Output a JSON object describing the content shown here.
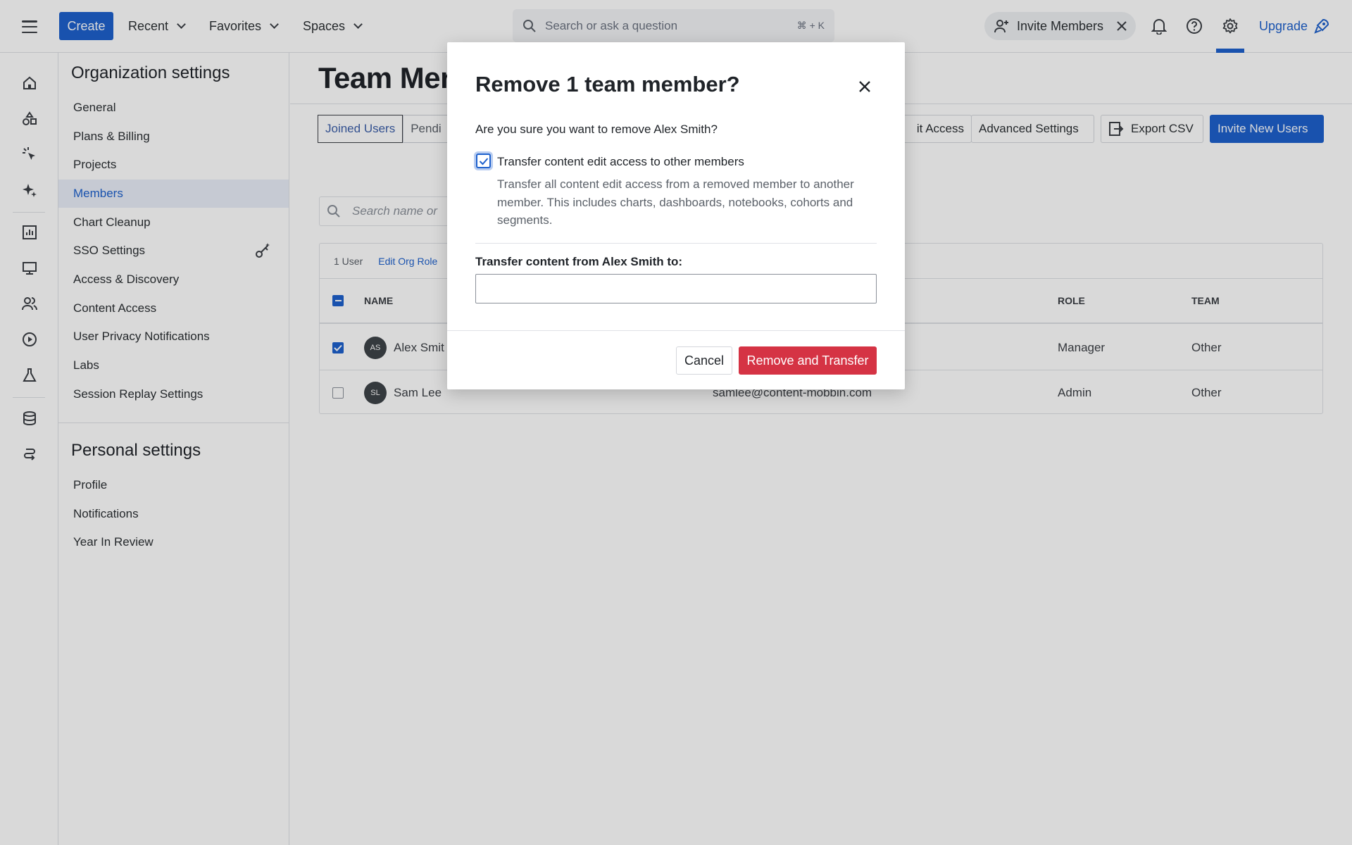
{
  "topbar": {
    "create_label": "Create",
    "menus": [
      "Recent",
      "Favorites",
      "Spaces"
    ],
    "search_placeholder": "Search or ask a question",
    "search_shortcut": "⌘ + K",
    "invite_label": "Invite Members",
    "upgrade_label": "Upgrade"
  },
  "rail_icons": [
    "home-icon",
    "shapes-icon",
    "click-sparkle-icon",
    "ai-sparkle-icon",
    "chart-icon",
    "monitor-icon",
    "users-icon",
    "replay-icon",
    "flask-icon",
    "database-icon",
    "routes-icon"
  ],
  "sidebar": {
    "org_heading": "Organization settings",
    "org_items": [
      "General",
      "Plans & Billing",
      "Projects",
      "Members",
      "Chart Cleanup",
      "SSO Settings",
      "Access & Discovery",
      "Content Access",
      "User Privacy Notifications",
      "Labs",
      "Session Replay Settings"
    ],
    "active_item": "Members",
    "personal_heading": "Personal settings",
    "personal_items": [
      "Profile",
      "Notifications",
      "Year In Review"
    ]
  },
  "main": {
    "title": "Team Mer",
    "tabs": [
      "Joined Users",
      "Pendi"
    ],
    "actions": {
      "edit_access": "it Access",
      "advanced_settings": "Advanced Settings",
      "export_csv": "Export CSV",
      "invite_new": "Invite New Users"
    },
    "search_placeholder": "Search name or",
    "table": {
      "selected_count": "1 User",
      "edit_org_role": "Edit Org Role",
      "headers": {
        "name": "NAME",
        "role": "ROLE",
        "team": "TEAM"
      },
      "rows": [
        {
          "initials": "AS",
          "name": "Alex Smit",
          "email": "",
          "role": "Manager",
          "team": "Other",
          "checked": true
        },
        {
          "initials": "SL",
          "name": "Sam Lee",
          "email": "samlee@content-mobbin.com",
          "role": "Admin",
          "team": "Other",
          "checked": false
        }
      ]
    }
  },
  "modal": {
    "title": "Remove 1 team member?",
    "question": "Are you sure you want to remove Alex Smith?",
    "checkbox_label": "Transfer content edit access to other members",
    "checkbox_checked": true,
    "checkbox_desc": "Transfer all content edit access from a removed member to another member. This includes charts, dashboards, notebooks, cohorts and segments.",
    "transfer_label": "Transfer content from Alex Smith to:",
    "transfer_value": "",
    "cancel_label": "Cancel",
    "confirm_label": "Remove and Transfer"
  },
  "colors": {
    "accent": "#1e61cd",
    "danger": "#d53344"
  }
}
